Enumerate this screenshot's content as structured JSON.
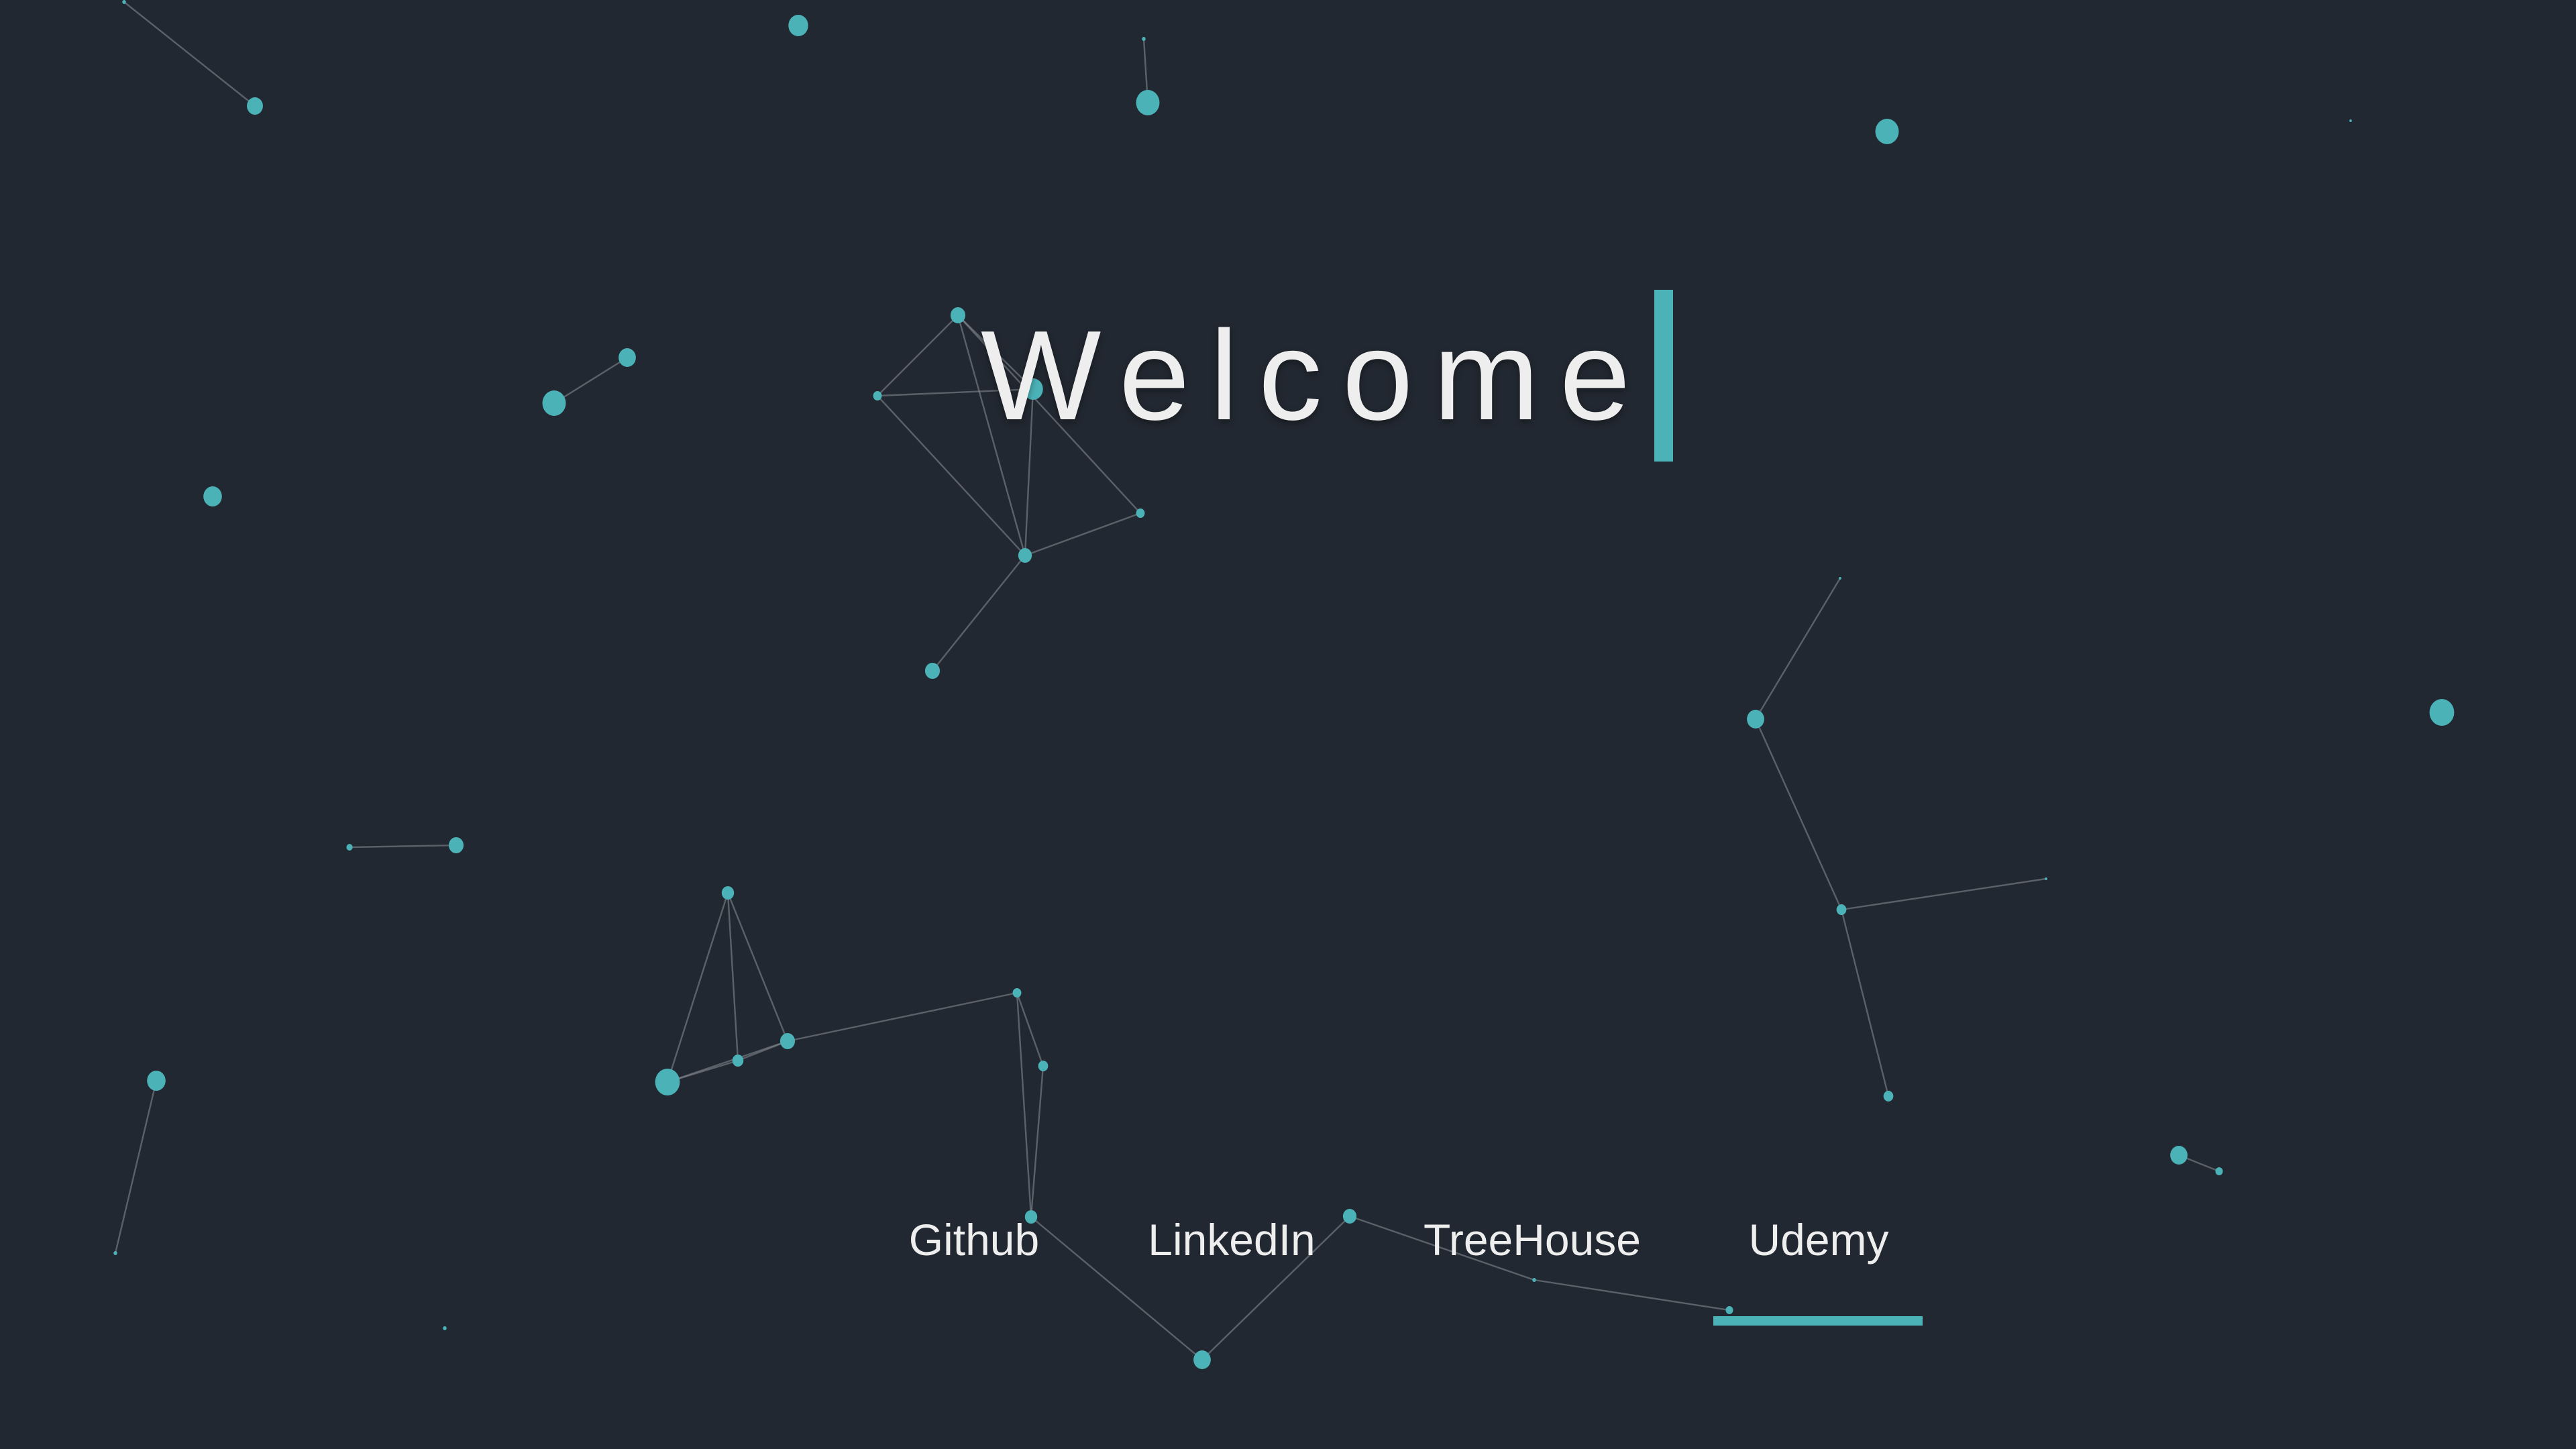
{
  "hero": {
    "title": "Welcome"
  },
  "nav": {
    "links": [
      {
        "label": "Github"
      },
      {
        "label": "LinkedIn"
      },
      {
        "label": "TreeHouse"
      },
      {
        "label": "Udemy"
      }
    ],
    "active_index": 3
  },
  "colors": {
    "background": "#222831",
    "accent": "#4bb3b8",
    "text": "#eeeeee",
    "line": "#8a8f96"
  }
}
